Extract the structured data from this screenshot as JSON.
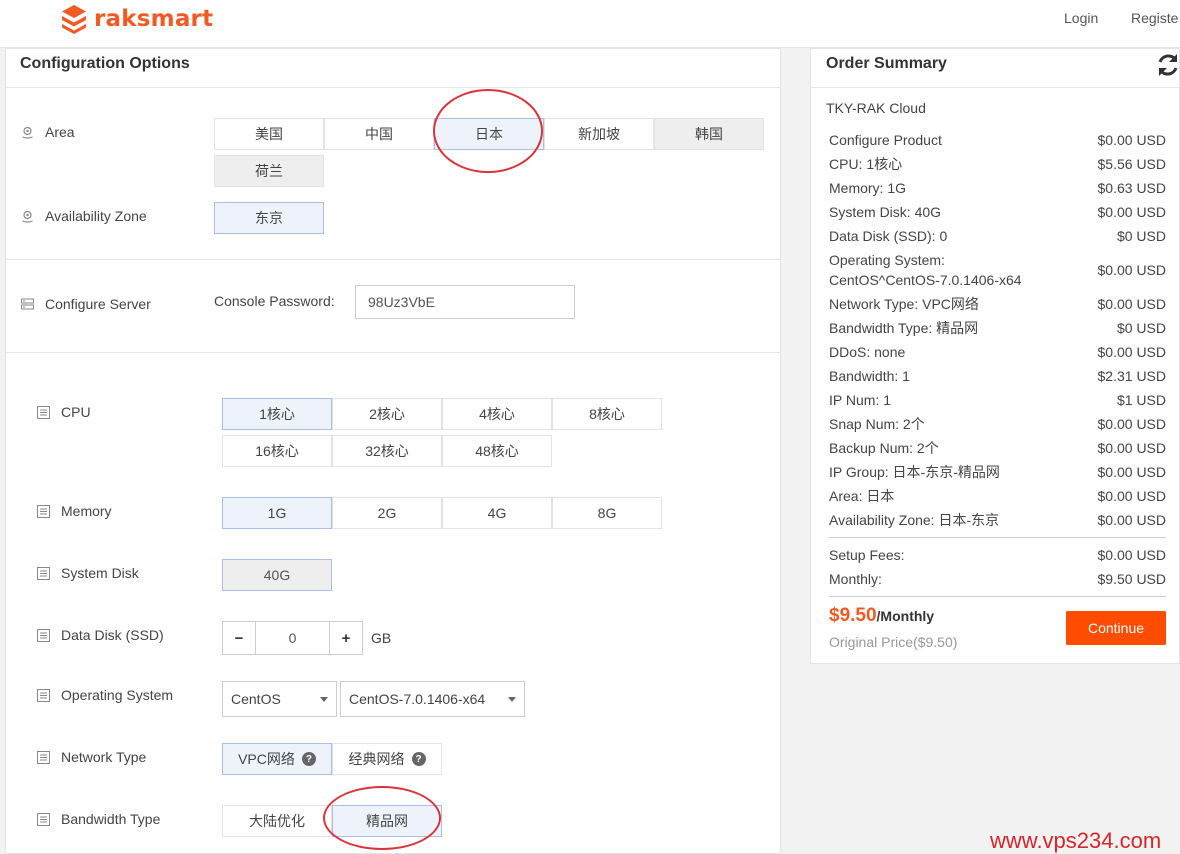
{
  "header": {
    "logo_text": "raksmart",
    "login": "Login",
    "register": "Registe"
  },
  "config": {
    "title": "Configuration Options",
    "area": {
      "label": "Area",
      "options": [
        "美国",
        "中国",
        "日本",
        "新加坡",
        "韩国",
        "荷兰"
      ],
      "selected": "日本"
    },
    "zone": {
      "label": "Availability Zone",
      "options": [
        "东京"
      ],
      "selected": "东京"
    },
    "server": {
      "label": "Configure Server",
      "password_label": "Console Password:",
      "password_value": "98Uz3VbE"
    },
    "cpu": {
      "label": "CPU",
      "options": [
        "1核心",
        "2核心",
        "4核心",
        "8核心",
        "16核心",
        "32核心",
        "48核心"
      ],
      "selected": "1核心"
    },
    "memory": {
      "label": "Memory",
      "options": [
        "1G",
        "2G",
        "4G",
        "8G"
      ],
      "selected": "1G"
    },
    "system_disk": {
      "label": "System Disk",
      "value": "40G"
    },
    "data_disk": {
      "label": "Data Disk (SSD)",
      "minus": "−",
      "value": "0",
      "plus": "+",
      "unit": "GB"
    },
    "os": {
      "label": "Operating System",
      "family": "CentOS",
      "version": "CentOS-7.0.1406-x64"
    },
    "network": {
      "label": "Network Type",
      "options": [
        "VPC网络",
        "经典网络"
      ],
      "selected": "VPC网络",
      "help_icon": "?"
    },
    "bandwidth_type": {
      "label": "Bandwidth Type",
      "options": [
        "大陆优化",
        "精品网"
      ],
      "selected": "精品网"
    }
  },
  "summary": {
    "title": "Order Summary",
    "product": "TKY-RAK Cloud",
    "lines": [
      {
        "label": "Configure Product",
        "value": "$0.00 USD"
      },
      {
        "label": "CPU: 1核心",
        "value": "$5.56 USD"
      },
      {
        "label": "Memory: 1G",
        "value": "$0.63 USD"
      },
      {
        "label": "System Disk: 40G",
        "value": "$0.00 USD"
      },
      {
        "label": "Data Disk (SSD): 0",
        "value": "$0 USD"
      },
      {
        "label": "Operating System:",
        "label2": "CentOS^CentOS-7.0.1406-x64",
        "value": "$0.00 USD"
      },
      {
        "label": "Network Type: VPC网络",
        "value": "$0.00 USD"
      },
      {
        "label": "Bandwidth Type: 精品网",
        "value": "$0 USD"
      },
      {
        "label": "DDoS: none",
        "value": "$0.00 USD"
      },
      {
        "label": "Bandwidth: 1",
        "value": "$2.31 USD"
      },
      {
        "label": "IP Num: 1",
        "value": "$1 USD"
      },
      {
        "label": "Snap Num: 2个",
        "value": "$0.00 USD"
      },
      {
        "label": "Backup Num: 2个",
        "value": "$0.00 USD"
      },
      {
        "label": "IP Group: 日本-东京-精品网",
        "value": "$0.00 USD"
      },
      {
        "label": "Area: 日本",
        "value": "$0.00 USD"
      },
      {
        "label": "Availability Zone: 日本-东京",
        "value": "$0.00 USD"
      }
    ],
    "setup_label": "Setup Fees:",
    "setup_value": "$0.00 USD",
    "monthly_label": "Monthly:",
    "monthly_value": "$9.50 USD",
    "total_amount": "$9.50",
    "total_period": "/Monthly",
    "original_price": "Original Price($9.50)",
    "continue": "Continue"
  },
  "watermark": "www.vps234.com",
  "colors": {
    "brand": "#f15a22",
    "continue_button": "#ff4d00",
    "selected_bg": "#eef3fb",
    "selected_border": "#a8c0e8",
    "annotation_circle": "#d9343a"
  }
}
